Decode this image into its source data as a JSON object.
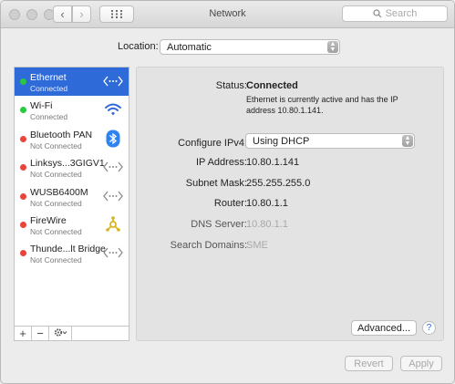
{
  "window": {
    "title": "Network",
    "search_placeholder": "Search",
    "nav_back": "‹",
    "nav_forward": "›",
    "grid_icon": "grid-icon",
    "search_icon": "search-icon"
  },
  "location": {
    "label": "Location:",
    "value": "Automatic"
  },
  "services": [
    {
      "name": "Ethernet",
      "status": "Connected",
      "status_color": "#28c840",
      "icon": "ethernet-icon",
      "selected": true
    },
    {
      "name": "Wi-Fi",
      "status": "Connected",
      "status_color": "#28c840",
      "icon": "wifi-icon",
      "selected": false
    },
    {
      "name": "Bluetooth PAN",
      "status": "Not Connected",
      "status_color": "#e8443b",
      "icon": "bluetooth-icon",
      "selected": false
    },
    {
      "name": "Linksys...3GIGV1",
      "status": "Not Connected",
      "status_color": "#e8443b",
      "icon": "ethernet-icon",
      "selected": false
    },
    {
      "name": "WUSB6400M",
      "status": "Not Connected",
      "status_color": "#e8443b",
      "icon": "ethernet-icon",
      "selected": false
    },
    {
      "name": "FireWire",
      "status": "Not Connected",
      "status_color": "#e8443b",
      "icon": "firewire-icon",
      "selected": false
    },
    {
      "name": "Thunde...lt Bridge",
      "status": "Not Connected",
      "status_color": "#e8443b",
      "icon": "ethernet-icon",
      "selected": false
    }
  ],
  "sidebar_controls": {
    "add": "+",
    "remove": "−",
    "action": "gear-icon"
  },
  "detail": {
    "status_label": "Status:",
    "status_value": "Connected",
    "status_note": "Ethernet is currently active and has the IP address 10.80.1.141.",
    "configure_label": "Configure IPv4:",
    "configure_value": "Using DHCP",
    "ip_label": "IP Address:",
    "ip_value": "10.80.1.141",
    "subnet_label": "Subnet Mask:",
    "subnet_value": "255.255.255.0",
    "router_label": "Router:",
    "router_value": "10.80.1.1",
    "dns_label": "DNS Server:",
    "dns_value": "10.80.1.1",
    "search_domains_label": "Search Domains:",
    "search_domains_value": "SME"
  },
  "buttons": {
    "advanced": "Advanced...",
    "help": "?",
    "revert": "Revert",
    "apply": "Apply"
  },
  "colors": {
    "accent": "#2f6ad9",
    "connected": "#28c840",
    "not_connected": "#e8443b"
  }
}
